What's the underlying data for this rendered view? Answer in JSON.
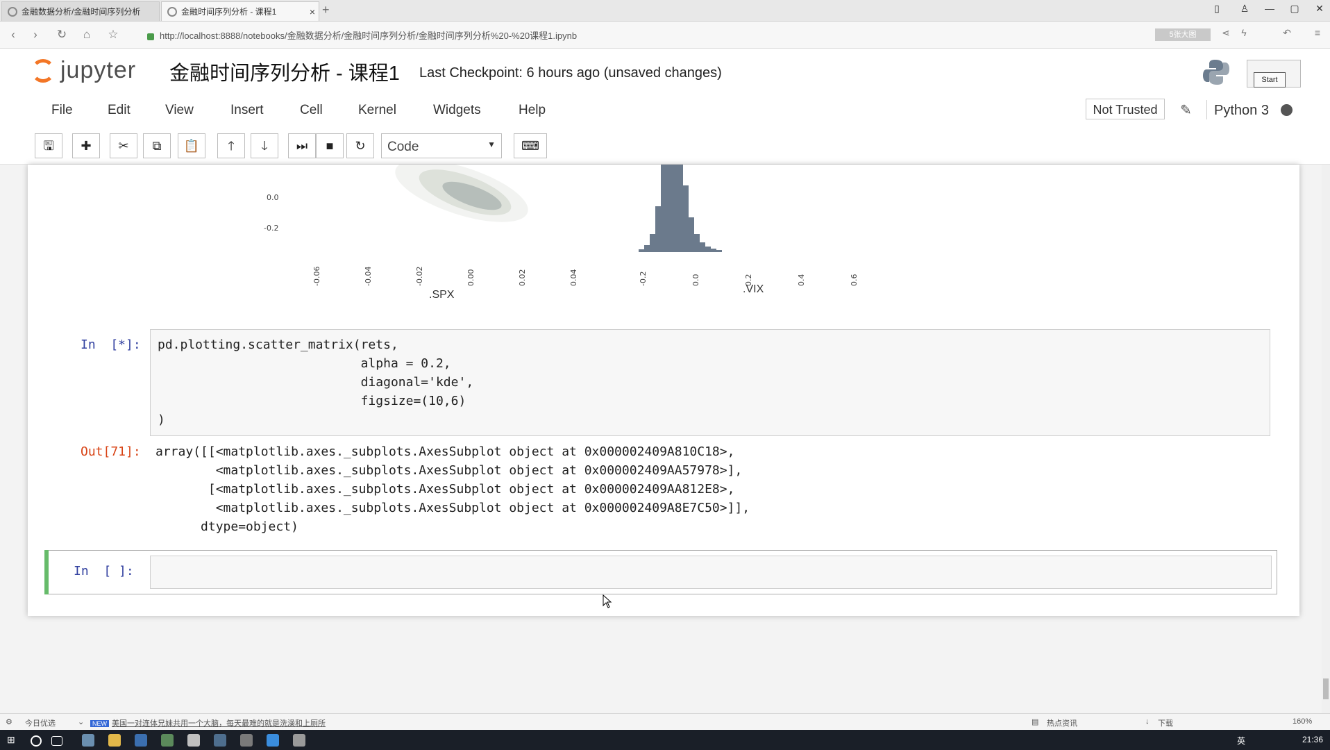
{
  "browser": {
    "tabs": [
      {
        "label": "金融数据分析/金融时间序列分析"
      },
      {
        "label": "金融时间序列分析 - 课程1"
      }
    ],
    "new_tab": "+",
    "url": "http://localhost:8888/notebooks/金融数据分析/金融时间序列分析/金融时间序列分析%20-%20课程1.ipynb",
    "address_badge": "5张大图",
    "window_controls": {
      "minimize": "—",
      "maximize": "▢",
      "close": "✕"
    }
  },
  "jupyter": {
    "logo_text": "jupyter",
    "notebook_title": "金融时间序列分析 - 课程1",
    "checkpoint": "Last Checkpoint: 6 hours ago (unsaved changes)",
    "start_tooltip": "Start",
    "menu": [
      "File",
      "Edit",
      "View",
      "Insert",
      "Cell",
      "Kernel",
      "Widgets",
      "Help"
    ],
    "trust": "Not Trusted",
    "kernel": "Python 3",
    "cell_type": "Code",
    "toolbar_icons": [
      "save-icon",
      "plus-icon",
      "cut-icon",
      "copy-icon",
      "paste-icon",
      "arrow-up-icon",
      "arrow-down-icon",
      "run-icon",
      "stop-icon",
      "restart-icon",
      "keyboard-icon"
    ]
  },
  "plot_fragment": {
    "y_ticks": [
      "0.0",
      "-0.2"
    ],
    "x_ticks_spx": [
      "-0.06",
      "-0.04",
      "-0.02",
      "0.00",
      "0.02",
      "0.04"
    ],
    "x_ticks_vix": [
      "-0.2",
      "0.0",
      "0.2",
      "0.4",
      "0.6"
    ],
    "xlabel_spx": ".SPX",
    "xlabel_vix": ".VIX"
  },
  "cells": [
    {
      "prompt": "In  [*]:",
      "code": "pd.plotting.scatter_matrix(rets,\n                           alpha = 0.2,\n                           diagonal='kde',\n                           figsize=(10,6)\n)"
    },
    {
      "prompt": "Out[71]:",
      "output": "array([[<matplotlib.axes._subplots.AxesSubplot object at 0x000002409A810C18>,\n        <matplotlib.axes._subplots.AxesSubplot object at 0x000002409AA57978>],\n       [<matplotlib.axes._subplots.AxesSubplot object at 0x000002409AA812E8>,\n        <matplotlib.axes._subplots.AxesSubplot object at 0x000002409A8E7C50>]],\n      dtype=object)"
    },
    {
      "prompt": "In  [ ]:",
      "code": ""
    }
  ],
  "statusbar": {
    "left_label": "今日优选",
    "news_badge": "NEW",
    "news": "美国一对连体兄妹共用一个大脑，每天最难的就是洗澡和上厕所",
    "hot": "热点资讯",
    "download": "下载",
    "zoom": "160%"
  },
  "taskbar": {
    "ime": "英",
    "time": "21:36"
  }
}
